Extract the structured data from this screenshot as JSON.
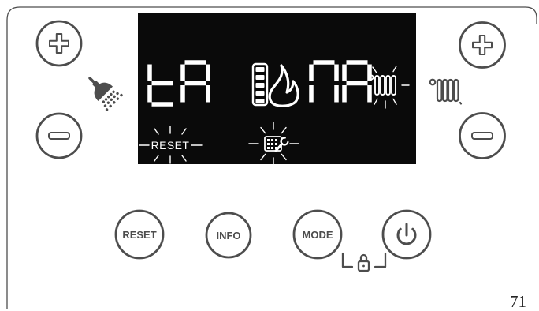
{
  "page": {
    "number": "71"
  },
  "colors": {
    "outline": "#4d4d4d",
    "lcd_background": "#0a0a0a",
    "lcd_segment": "#ffffff",
    "page_number": "#222222"
  },
  "display": {
    "left_code": "tA",
    "right_code": "ПA",
    "burner_level": {
      "icon": "burner-level-bar-icon",
      "bars_lit": 5,
      "bars_total": 5
    },
    "flame": {
      "icon": "flame-icon",
      "on": true
    },
    "heating": {
      "icon": "radiator-icon",
      "flashing": true
    },
    "reset_indicator": {
      "label": "RESET",
      "flashing": true
    },
    "service": {
      "icon": "service-wrench-icon",
      "flashing": true
    }
  },
  "dhw_controls": {
    "icon": "shower-icon",
    "increase": {
      "icon": "plus-icon"
    },
    "decrease": {
      "icon": "minus-icon"
    }
  },
  "heating_controls": {
    "icon": "radiator-icon",
    "increase": {
      "icon": "plus-icon"
    },
    "decrease": {
      "icon": "minus-icon"
    }
  },
  "buttons": {
    "reset": {
      "label": "RESET"
    },
    "info": {
      "label": "INFO"
    },
    "mode": {
      "label": "MODE"
    },
    "power": {
      "icon": "power-icon"
    }
  },
  "key_lock": {
    "icon": "lock-icon"
  }
}
